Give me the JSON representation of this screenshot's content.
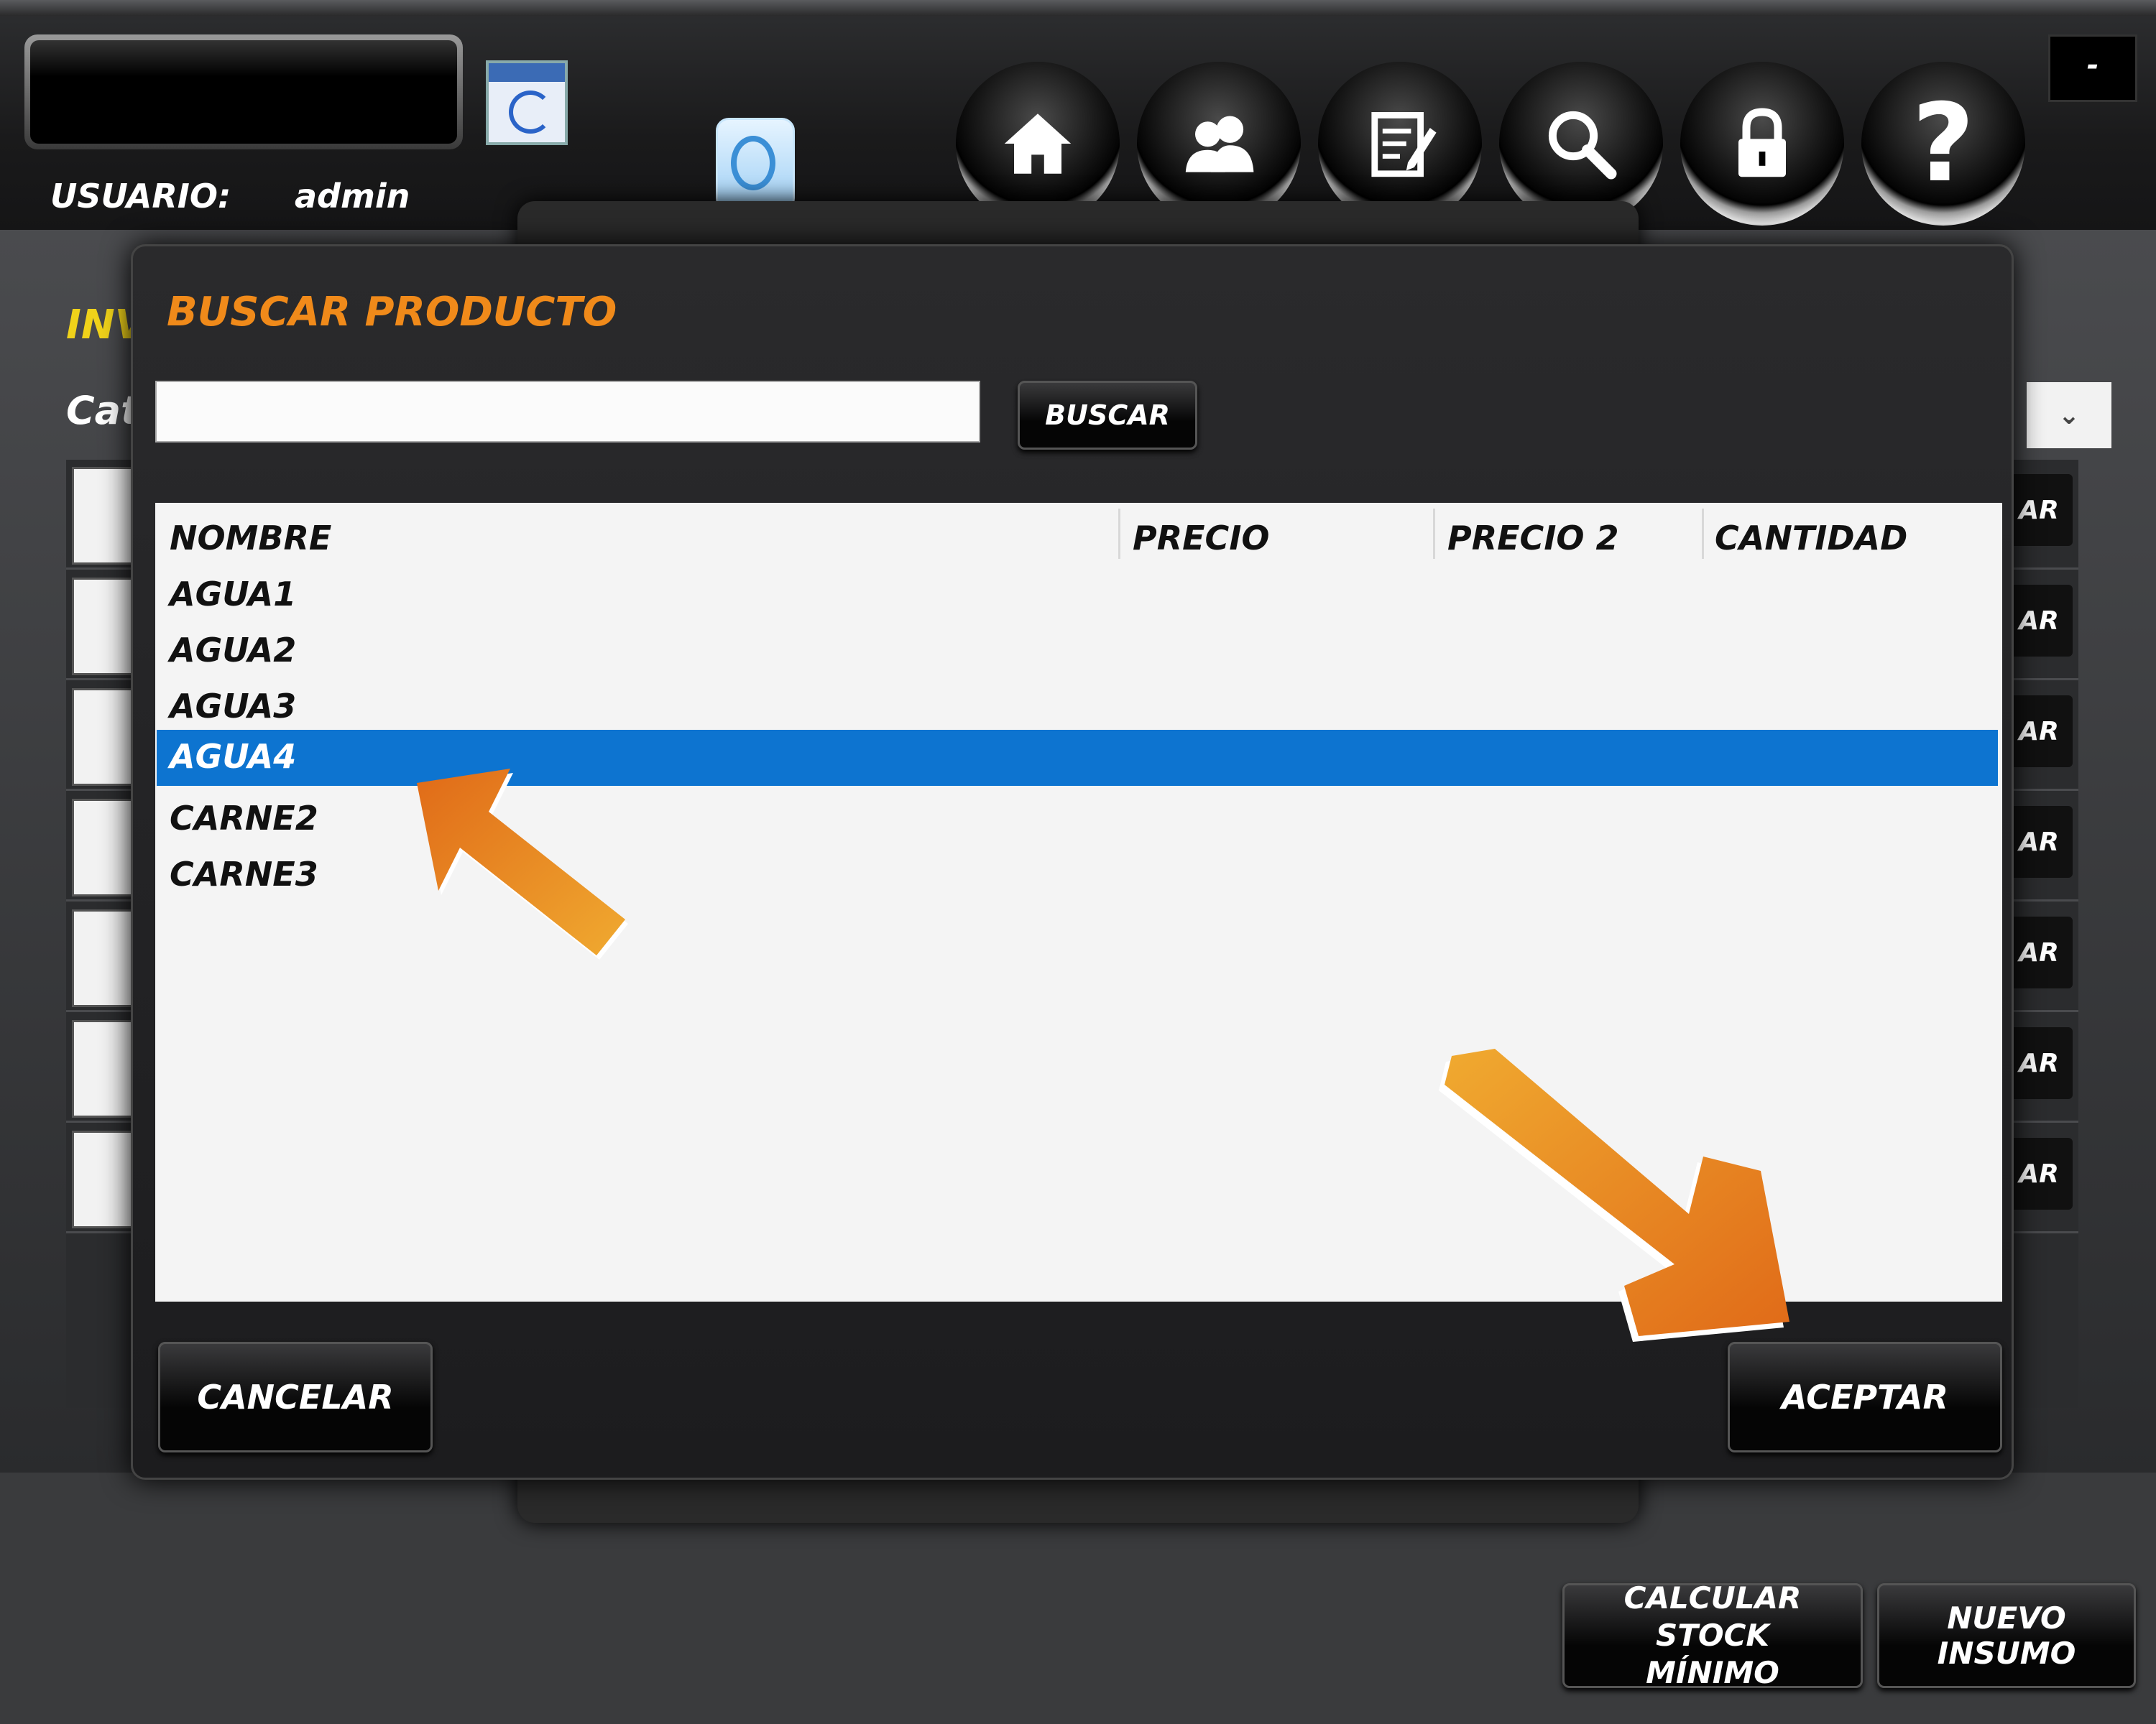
{
  "header": {
    "user_label": "USUARIO:",
    "user_name": "admin",
    "minimize_label": "-",
    "nav_icons": [
      "home-icon",
      "users-icon",
      "notes-icon",
      "search-icon",
      "lock-icon",
      "help-icon"
    ],
    "help_glyph": "?"
  },
  "background": {
    "title_fragment": "INV",
    "category_fragment": "Cat",
    "row_button_fragment": "AR",
    "page_select_glyph": "⌄"
  },
  "dialog": {
    "title": "BUSCAR PRODUCTO",
    "search": {
      "value": "",
      "placeholder": ""
    },
    "search_button": "BUSCAR",
    "table": {
      "columns": [
        "NOMBRE",
        "PRECIO",
        "PRECIO 2",
        "CANTIDAD"
      ],
      "rows": [
        "AGUA1",
        "AGUA2",
        "AGUA3",
        "AGUA4",
        "CARNE2",
        "CARNE3"
      ],
      "selected_index": 3
    },
    "cancel_button": "CANCELAR",
    "accept_button": "ACEPTAR"
  },
  "footer": {
    "calc_button_line1": "CALCULAR STOCK",
    "calc_button_line2": "MÍNIMO",
    "new_button": "NUEVO INSUMO"
  },
  "colors": {
    "selection": "#0d74d0",
    "title_orange": "#f08a1a",
    "background_title_yellow": "#f0d21a",
    "arrow_orange": "#e8861c"
  }
}
